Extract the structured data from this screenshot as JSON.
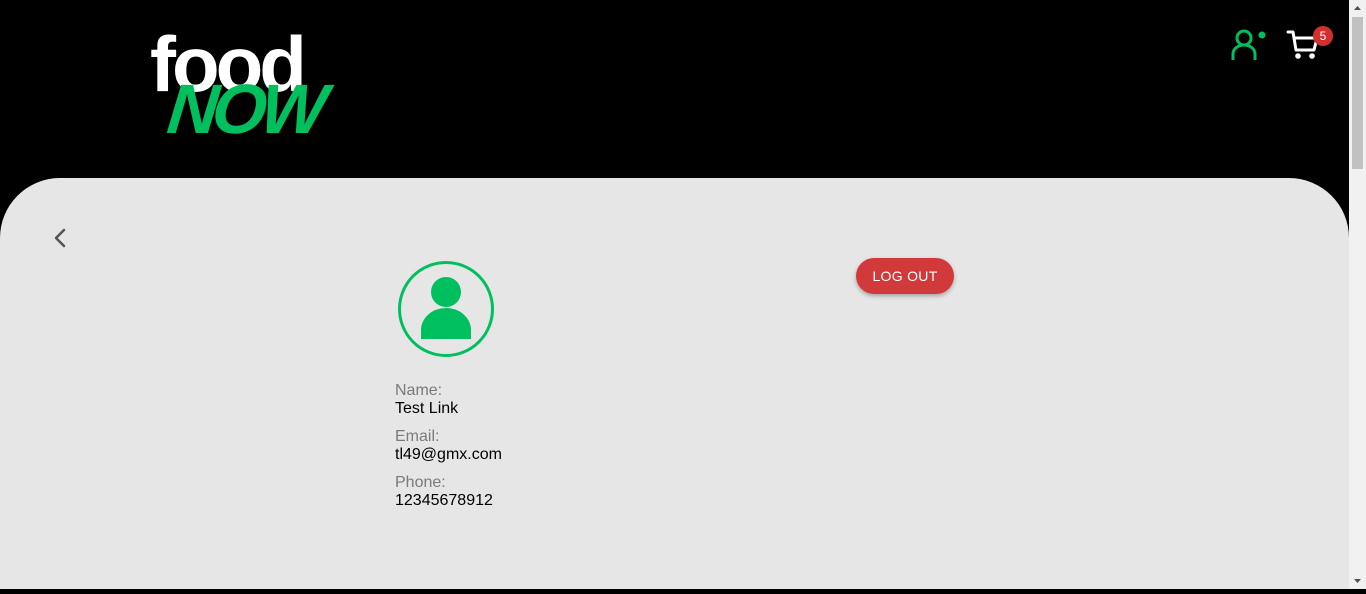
{
  "header": {
    "logo": {
      "top_text": "food",
      "bottom_text": "NOW"
    },
    "user_icon": "user-icon",
    "cart": {
      "icon": "cart-icon",
      "badge_count": "5"
    }
  },
  "colors": {
    "brand_green": "#00bf5f",
    "logout_red": "#d2393b",
    "badge_red": "#d32f2f",
    "content_bg": "#e7e6e6",
    "header_bg": "#000000"
  },
  "profile": {
    "back_icon": "chevron-left-icon",
    "avatar_icon": "person-icon",
    "logout_label": "LOG OUT",
    "fields": [
      {
        "label": "Name:",
        "value": "Test Link"
      },
      {
        "label": "Email:",
        "value": "tl49@gmx.com"
      },
      {
        "label": "Phone:",
        "value": "12345678912"
      }
    ]
  }
}
